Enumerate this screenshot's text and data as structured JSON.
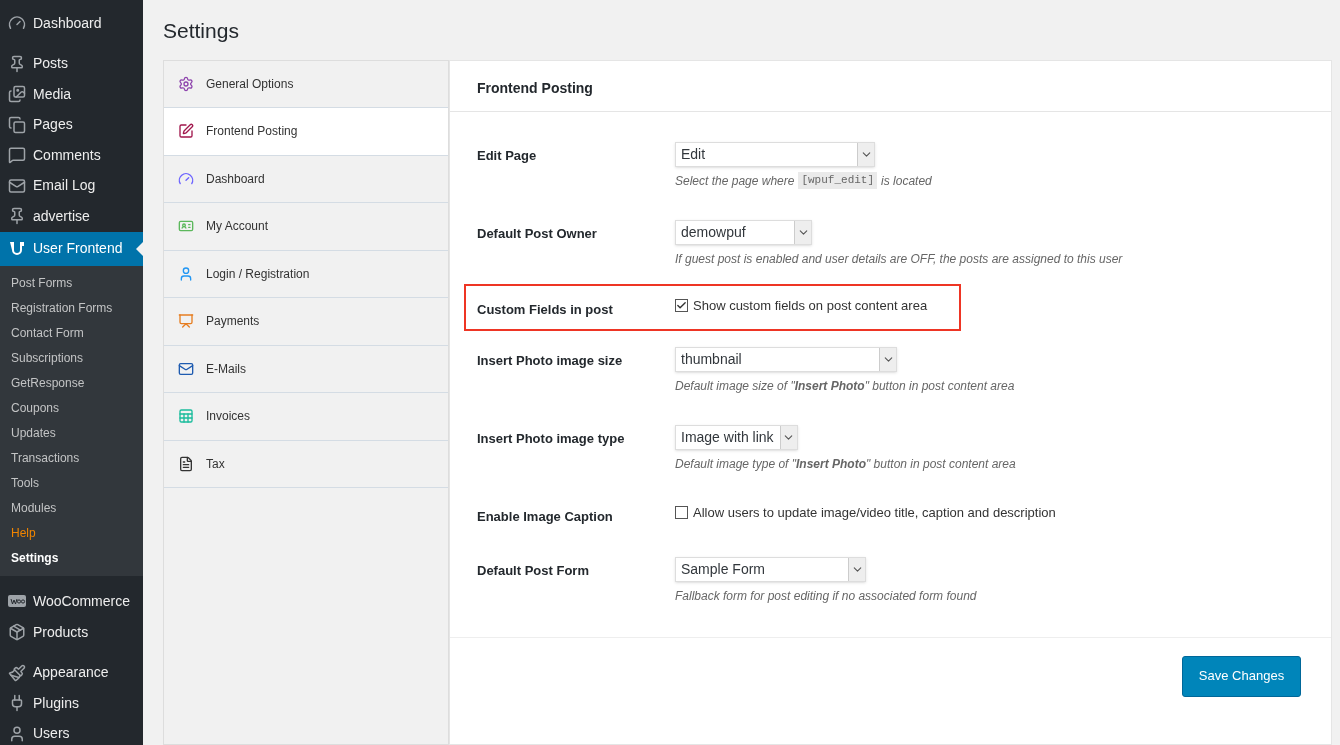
{
  "sidebar": {
    "groups": [
      {
        "items": [
          {
            "label": "Dashboard",
            "selected": false
          }
        ]
      },
      {
        "items": [
          {
            "label": "Posts",
            "selected": false
          },
          {
            "label": "Media",
            "selected": false
          },
          {
            "label": "Pages",
            "selected": false
          },
          {
            "label": "Comments",
            "selected": false
          },
          {
            "label": "Email Log",
            "selected": false
          },
          {
            "label": "advertise",
            "selected": false
          },
          {
            "label": "User Frontend",
            "selected": true,
            "children": [
              {
                "label": "Post Forms",
                "selected": false,
                "accent": false
              },
              {
                "label": "Registration Forms",
                "selected": false,
                "accent": false
              },
              {
                "label": "Contact Form",
                "selected": false,
                "accent": false
              },
              {
                "label": "Subscriptions",
                "selected": false,
                "accent": false
              },
              {
                "label": "GetResponse",
                "selected": false,
                "accent": false
              },
              {
                "label": "Coupons",
                "selected": false,
                "accent": false
              },
              {
                "label": "Updates",
                "selected": false,
                "accent": false
              },
              {
                "label": "Transactions",
                "selected": false,
                "accent": false
              },
              {
                "label": "Tools",
                "selected": false,
                "accent": false
              },
              {
                "label": "Modules",
                "selected": false,
                "accent": false
              },
              {
                "label": "Help",
                "selected": false,
                "accent": true
              },
              {
                "label": "Settings",
                "selected": true,
                "accent": false
              }
            ]
          }
        ]
      },
      {
        "items": [
          {
            "label": "WooCommerce",
            "selected": false
          },
          {
            "label": "Products",
            "selected": false
          }
        ]
      },
      {
        "items": [
          {
            "label": "Appearance",
            "selected": false
          },
          {
            "label": "Plugins",
            "selected": false
          },
          {
            "label": "Users",
            "selected": false
          }
        ]
      }
    ]
  },
  "page_title": "Settings",
  "tabs": [
    {
      "label": "General Options",
      "selected": false
    },
    {
      "label": "Frontend Posting",
      "selected": true
    },
    {
      "label": "Dashboard",
      "selected": false
    },
    {
      "label": "My Account",
      "selected": false
    },
    {
      "label": "Login / Registration",
      "selected": false
    },
    {
      "label": "Payments",
      "selected": false
    },
    {
      "label": "E-Mails",
      "selected": false
    },
    {
      "label": "Invoices",
      "selected": false
    },
    {
      "label": "Tax",
      "selected": false
    }
  ],
  "section_title": "Frontend Posting",
  "rows": [
    {
      "label": "Edit Page",
      "kind": "select",
      "value": "Edit",
      "highlighted": false,
      "description": [
        {
          "kind": "text",
          "text": "Select the page where"
        },
        {
          "kind": "code",
          "text": "[wpuf_edit]"
        },
        {
          "kind": "text",
          "text": "is located"
        }
      ]
    },
    {
      "label": "Default Post Owner",
      "kind": "select",
      "value": "demowpuf",
      "highlighted": false,
      "description": [
        {
          "kind": "text",
          "text": "If guest post is enabled and user details are OFF, the posts are assigned to this user"
        }
      ]
    },
    {
      "label": "Custom Fields in post",
      "kind": "checkbox",
      "checked": true,
      "text": "Show custom fields on post content area",
      "highlighted": true
    },
    {
      "label": "Insert Photo image size",
      "kind": "select",
      "value": "thumbnail",
      "highlighted": false,
      "description": [
        {
          "kind": "text",
          "text": "Default image size of \"**Insert Photo**\" button in post content area"
        }
      ]
    },
    {
      "label": "Insert Photo image type",
      "kind": "select",
      "value": "Image with link",
      "highlighted": false,
      "description": [
        {
          "kind": "text",
          "text": "Default image type of \"**Insert Photo**\" button in post content area"
        }
      ]
    },
    {
      "label": "Enable Image Caption",
      "kind": "checkbox",
      "checked": false,
      "text": "Allow users to update image/video title, caption and description",
      "highlighted": false
    },
    {
      "label": "Default Post Form",
      "kind": "select",
      "value": "Sample Form",
      "highlighted": false,
      "description": [
        {
          "kind": "text",
          "text": "Fallback form for post editing if no associated form found"
        }
      ]
    }
  ],
  "save_button": "Save Changes"
}
